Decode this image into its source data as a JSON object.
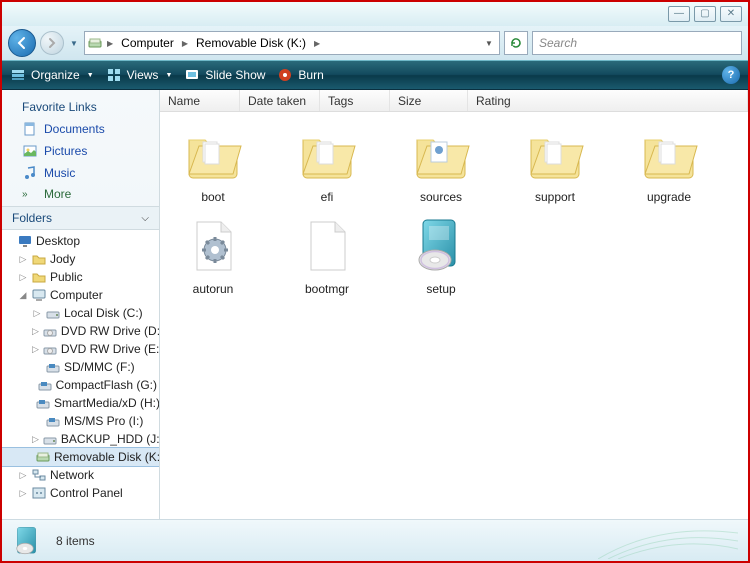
{
  "titlebar": {
    "min": "—",
    "max": "▢",
    "close": "✕"
  },
  "nav": {
    "breadcrumbs": [
      "Computer",
      "Removable Disk (K:)"
    ],
    "search_placeholder": "Search"
  },
  "toolbar": {
    "organize": "Organize",
    "views": "Views",
    "slideshow": "Slide Show",
    "burn": "Burn"
  },
  "navpane": {
    "fav_header": "Favorite Links",
    "favorites": [
      "Documents",
      "Pictures",
      "Music"
    ],
    "more": "More",
    "folders_header": "Folders",
    "tree": {
      "desktop": "Desktop",
      "user": "Jody",
      "public": "Public",
      "computer": "Computer",
      "drives": [
        "Local Disk (C:)",
        "DVD RW Drive (D:)",
        "DVD RW Drive (E:)",
        "SD/MMC (F:)",
        "CompactFlash (G:)",
        "SmartMedia/xD (H:)",
        "MS/MS Pro (I:)",
        "BACKUP_HDD (J:)",
        "Removable Disk (K:)"
      ],
      "network": "Network",
      "controlpanel": "Control Panel"
    }
  },
  "columns": [
    "Name",
    "Date taken",
    "Tags",
    "Size",
    "Rating"
  ],
  "items": [
    {
      "name": "boot",
      "type": "folder"
    },
    {
      "name": "efi",
      "type": "folder"
    },
    {
      "name": "sources",
      "type": "folder"
    },
    {
      "name": "support",
      "type": "folder"
    },
    {
      "name": "upgrade",
      "type": "folder"
    },
    {
      "name": "autorun",
      "type": "inf"
    },
    {
      "name": "bootmgr",
      "type": "file"
    },
    {
      "name": "setup",
      "type": "setup"
    }
  ],
  "status": {
    "count": "8 items"
  }
}
